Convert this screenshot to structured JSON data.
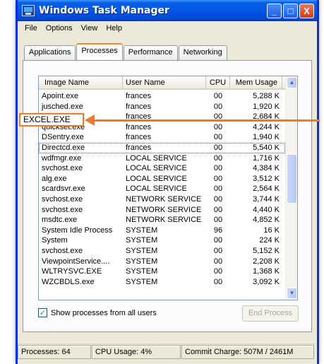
{
  "window": {
    "title": "Windows Task Manager",
    "controls": [
      "_",
      "□",
      "X"
    ]
  },
  "menu": [
    "File",
    "Options",
    "View",
    "Help"
  ],
  "tabs": [
    {
      "label": "Applications",
      "active": false
    },
    {
      "label": "Processes",
      "active": true
    },
    {
      "label": "Performance",
      "active": false
    },
    {
      "label": "Networking",
      "active": false
    }
  ],
  "columns": {
    "name": "Image Name",
    "user": "User Name",
    "cpu": "CPU",
    "mem": "Mem Usage"
  },
  "processes": [
    {
      "name": "Apoint.exe",
      "user": "frances",
      "cpu": "00",
      "mem": "5,288 K"
    },
    {
      "name": "jusched.exe",
      "user": "frances",
      "cpu": "00",
      "mem": "1,920 K"
    },
    {
      "name": "EXCEL.EXE",
      "user": "frances",
      "cpu": "00",
      "mem": "2,684 K"
    },
    {
      "name": "quickset.exe",
      "user": "frances",
      "cpu": "00",
      "mem": "4,244 K"
    },
    {
      "name": "DSentry.exe",
      "user": "frances",
      "cpu": "00",
      "mem": "1,940 K"
    },
    {
      "name": "Directcd.exe",
      "user": "frances",
      "cpu": "00",
      "mem": "5,540 K"
    },
    {
      "name": "wdfmgr.exe",
      "user": "LOCAL SERVICE",
      "cpu": "00",
      "mem": "1,716 K"
    },
    {
      "name": "svchost.exe",
      "user": "LOCAL SERVICE",
      "cpu": "00",
      "mem": "4,384 K"
    },
    {
      "name": "alg.exe",
      "user": "LOCAL SERVICE",
      "cpu": "00",
      "mem": "3,512 K"
    },
    {
      "name": "scardsvr.exe",
      "user": "LOCAL SERVICE",
      "cpu": "00",
      "mem": "2,564 K"
    },
    {
      "name": "svchost.exe",
      "user": "NETWORK SERVICE",
      "cpu": "00",
      "mem": "3,744 K"
    },
    {
      "name": "svchost.exe",
      "user": "NETWORK SERVICE",
      "cpu": "00",
      "mem": "4,440 K"
    },
    {
      "name": "msdtc.exe",
      "user": "NETWORK SERVICE",
      "cpu": "00",
      "mem": "4,852 K"
    },
    {
      "name": "System Idle Process",
      "user": "SYSTEM",
      "cpu": "96",
      "mem": "16 K"
    },
    {
      "name": "System",
      "user": "SYSTEM",
      "cpu": "00",
      "mem": "224 K"
    },
    {
      "name": "svchost.exe",
      "user": "SYSTEM",
      "cpu": "00",
      "mem": "5,152 K"
    },
    {
      "name": "ViewpointService....",
      "user": "SYSTEM",
      "cpu": "00",
      "mem": "2,208 K"
    },
    {
      "name": "WLTRYSVC.EXE",
      "user": "SYSTEM",
      "cpu": "00",
      "mem": "1,368 K"
    },
    {
      "name": "WZCBDLS.exe",
      "user": "SYSTEM",
      "cpu": "00",
      "mem": "3,092 K"
    }
  ],
  "highlight_label": "EXCEL.EXE",
  "show_all_label": "Show processes from all users",
  "show_all_checked": true,
  "end_process_label": "End Process",
  "status": {
    "processes": "Processes: 64",
    "cpu": "CPU Usage: 4%",
    "commit": "Commit Charge: 507M / 2461M"
  },
  "colors": {
    "titlebar": "#0058e6",
    "annotation": "#f07a2a",
    "window_bg": "#ece9d8"
  }
}
